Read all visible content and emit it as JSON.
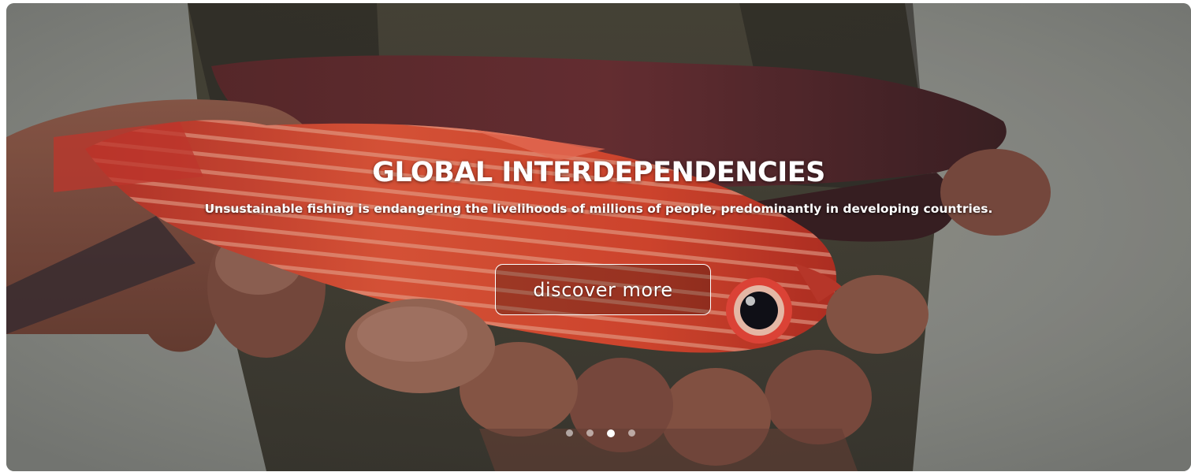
{
  "slide": {
    "title": "GLOBAL INTERDEPENDENCIES",
    "description": "Unsustainable fishing is endangering the livelihoods of millions of people, predominantly in developing countries.",
    "button_label": "discover more"
  },
  "carousel": {
    "slide_count": 4,
    "active_index": 2
  },
  "colors": {
    "text": "#ffffff",
    "fish_red": "#d8452e",
    "dark_fish": "#4b2a2d",
    "background_grey": "#8f9189"
  },
  "icons": [
    "carousel-dot-icon"
  ]
}
